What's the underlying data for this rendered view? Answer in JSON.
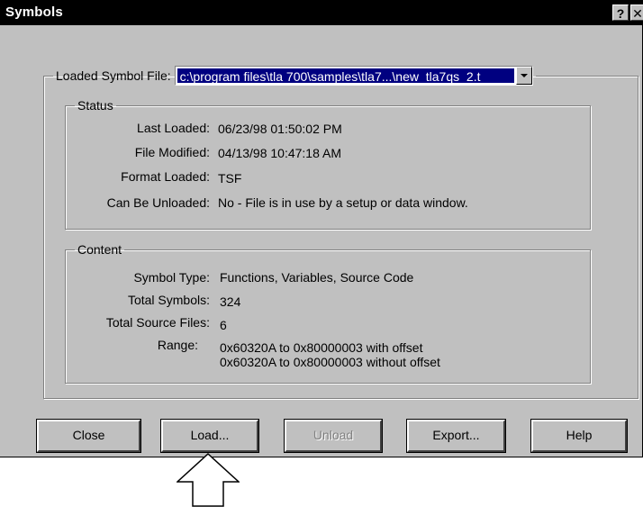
{
  "window": {
    "title": "Symbols",
    "help_glyph": "?",
    "close_glyph": "✕"
  },
  "loaded_symbol_file": {
    "label": "Loaded Symbol File:",
    "value": "c:\\program files\\tla 700\\samples\\tla7...\\new_tla7qs_2.t"
  },
  "status": {
    "title": "Status",
    "rows": [
      {
        "label": "Last Loaded:",
        "value": "06/23/98 01:50:02 PM"
      },
      {
        "label": "File Modified:",
        "value": "04/13/98 10:47:18 AM"
      },
      {
        "label": "Format Loaded:",
        "value": "TSF"
      },
      {
        "label": "Can Be Unloaded:",
        "value": "No - File is in use by a setup or data window."
      }
    ]
  },
  "content": {
    "title": "Content",
    "rows": [
      {
        "label": "Symbol Type:",
        "value": "Functions, Variables, Source Code"
      },
      {
        "label": "Total Symbols:",
        "value": "324"
      },
      {
        "label": "Total Source Files:",
        "value": "6"
      }
    ],
    "range": {
      "label": "Range:",
      "line1": "0x60320A to 0x80000003 with offset",
      "line2": "0x60320A to 0x80000003 without offset"
    }
  },
  "buttons": {
    "close": "Close",
    "load": "Load...",
    "unload": "Unload",
    "export": "Export...",
    "help": "Help"
  },
  "icons": {
    "dropdown": "chevron-down-icon",
    "pointer": "up-arrow-icon"
  },
  "colors": {
    "face": "#c0c0c0",
    "titlebar": "#000000",
    "selection": "#000080",
    "disabled_text": "#808080"
  }
}
